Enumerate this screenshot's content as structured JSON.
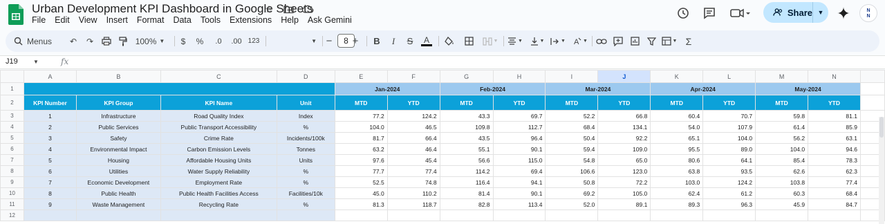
{
  "app": {
    "title": "Urban Development KPI Dashboard in Google Sheets",
    "menus": [
      "File",
      "Edit",
      "View",
      "Insert",
      "Format",
      "Data",
      "Tools",
      "Extensions",
      "Help",
      "Ask Gemini"
    ],
    "share_label": "Share",
    "avatar_text": "N\nN"
  },
  "toolbar": {
    "search_label": "Menus",
    "zoom": "100%",
    "currency": "$",
    "percent": "%",
    "dec_decrease": ".0",
    "dec_increase": ".00",
    "number_format": "123",
    "font_size": "8"
  },
  "formula_bar": {
    "cell_ref": "J19",
    "fx": "fx"
  },
  "grid": {
    "columns": [
      "A",
      "B",
      "C",
      "D",
      "E",
      "F",
      "G",
      "H",
      "I",
      "J",
      "K",
      "L",
      "M",
      "N"
    ],
    "row_numbers": [
      "1",
      "2",
      "3",
      "4",
      "5",
      "6",
      "7",
      "8",
      "9",
      "10",
      "11",
      "12"
    ],
    "months": [
      "Jan-2024",
      "Feb-2024",
      "Mar-2024",
      "Apr-2024",
      "May-2024"
    ],
    "headers": [
      "KPI Number",
      "KPI Group",
      "KPI Name",
      "Unit"
    ],
    "mtd": "MTD",
    "ytd": "YTD",
    "rows": [
      {
        "num": "1",
        "group": "Infrastructure",
        "name": "Road Quality Index",
        "unit": "Index",
        "vals": [
          "77.2",
          "124.2",
          "43.3",
          "69.7",
          "52.2",
          "66.8",
          "60.4",
          "70.7",
          "59.8",
          "81.1"
        ]
      },
      {
        "num": "2",
        "group": "Public Services",
        "name": "Public Transport Accessibility",
        "unit": "%",
        "vals": [
          "104.0",
          "46.5",
          "109.8",
          "112.7",
          "68.4",
          "134.1",
          "54.0",
          "107.9",
          "61.4",
          "85.9"
        ]
      },
      {
        "num": "3",
        "group": "Safety",
        "name": "Crime Rate",
        "unit": "Incidents/100k",
        "vals": [
          "81.7",
          "66.4",
          "43.5",
          "96.4",
          "50.4",
          "92.2",
          "65.1",
          "104.0",
          "56.2",
          "63.1"
        ]
      },
      {
        "num": "4",
        "group": "Environmental Impact",
        "name": "Carbon Emission Levels",
        "unit": "Tonnes",
        "vals": [
          "63.2",
          "46.4",
          "55.1",
          "90.1",
          "59.4",
          "109.0",
          "95.5",
          "89.0",
          "104.0",
          "94.6"
        ]
      },
      {
        "num": "5",
        "group": "Housing",
        "name": "Affordable Housing Units",
        "unit": "Units",
        "vals": [
          "97.6",
          "45.4",
          "56.6",
          "115.0",
          "54.8",
          "65.0",
          "80.6",
          "64.1",
          "85.4",
          "78.3"
        ]
      },
      {
        "num": "6",
        "group": "Utilities",
        "name": "Water Supply Reliability",
        "unit": "%",
        "vals": [
          "77.7",
          "77.4",
          "114.2",
          "69.4",
          "106.6",
          "123.0",
          "63.8",
          "93.5",
          "62.6",
          "62.3"
        ]
      },
      {
        "num": "7",
        "group": "Economic Development",
        "name": "Employment Rate",
        "unit": "%",
        "vals": [
          "52.5",
          "74.8",
          "116.4",
          "94.1",
          "50.8",
          "72.2",
          "103.0",
          "124.2",
          "103.8",
          "77.4"
        ]
      },
      {
        "num": "8",
        "group": "Public Health",
        "name": "Public Health Facilities Access",
        "unit": "Facilities/10k",
        "vals": [
          "45.0",
          "110.2",
          "81.4",
          "90.1",
          "69.2",
          "105.0",
          "62.4",
          "61.2",
          "60.3",
          "68.4"
        ]
      },
      {
        "num": "9",
        "group": "Waste Management",
        "name": "Recycling Rate",
        "unit": "%",
        "vals": [
          "81.3",
          "118.7",
          "82.8",
          "113.4",
          "52.0",
          "89.1",
          "89.3",
          "96.3",
          "45.9",
          "84.7"
        ]
      }
    ]
  },
  "colors": {
    "header_blue": "#0ca1d9",
    "month_blue": "#9cc9ef",
    "kpi_light": "#dde8f6",
    "share_bg": "#c2e7ff"
  }
}
